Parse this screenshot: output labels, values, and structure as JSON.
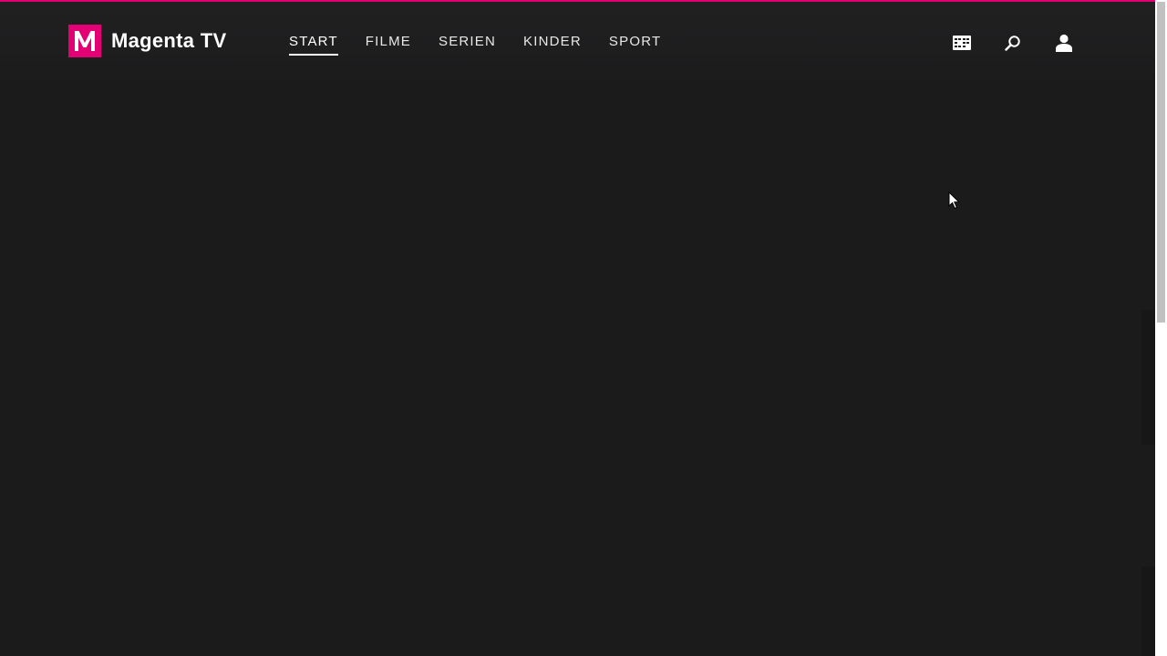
{
  "header": {
    "brand": {
      "logo_letter": "M",
      "name": "Magenta TV",
      "accent_color": "#e20074"
    },
    "nav": [
      {
        "label": "START",
        "active": true
      },
      {
        "label": "FILME",
        "active": false
      },
      {
        "label": "SERIEN",
        "active": false
      },
      {
        "label": "KINDER",
        "active": false
      },
      {
        "label": "SPORT",
        "active": false
      }
    ],
    "icons": [
      "tv-guide-icon",
      "search-icon",
      "user-icon"
    ]
  },
  "theme": {
    "background": "#1b1b1c",
    "text": "#ffffff",
    "accent": "#e20074"
  }
}
